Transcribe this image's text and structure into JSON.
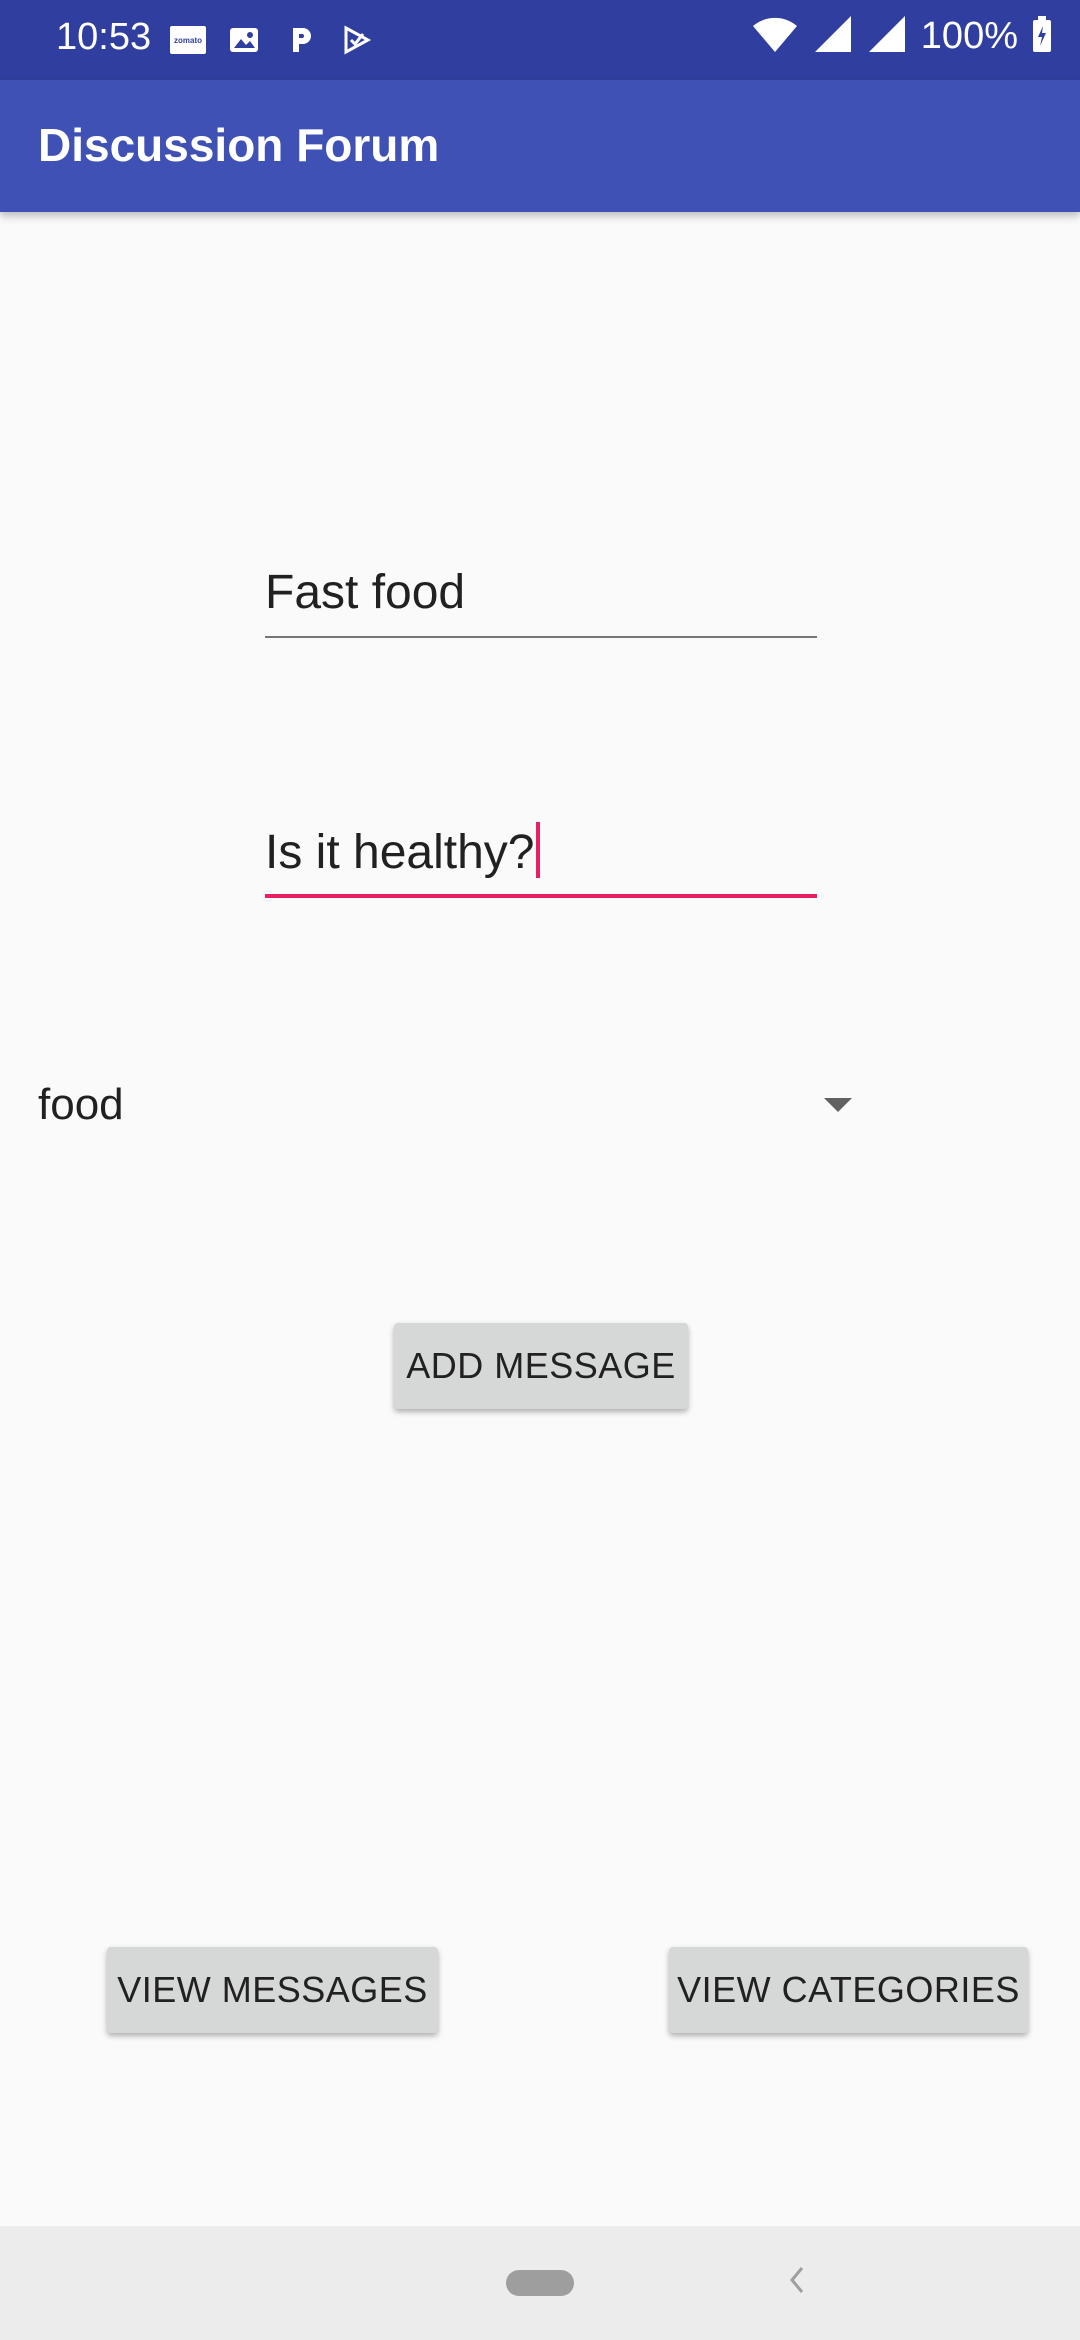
{
  "status_bar": {
    "time": "10:53",
    "battery": "100%",
    "notifications": [
      "zomato-icon",
      "image-icon",
      "paytm-icon",
      "play-store-icon"
    ],
    "zomato_label": "zomato"
  },
  "app_bar": {
    "title": "Discussion Forum",
    "color": "#3f51b5",
    "status_color": "#303f9f"
  },
  "form": {
    "title_field": {
      "value": "Fast food"
    },
    "message_field": {
      "value": "Is it healthy?",
      "focused": true
    },
    "category_spinner": {
      "selected": "food"
    },
    "add_button_label": "ADD MESSAGE"
  },
  "bottom_actions": {
    "view_messages_label": "VIEW MESSAGES",
    "view_categories_label": "VIEW CATEGORIES"
  },
  "accent_color": "#e91e63"
}
